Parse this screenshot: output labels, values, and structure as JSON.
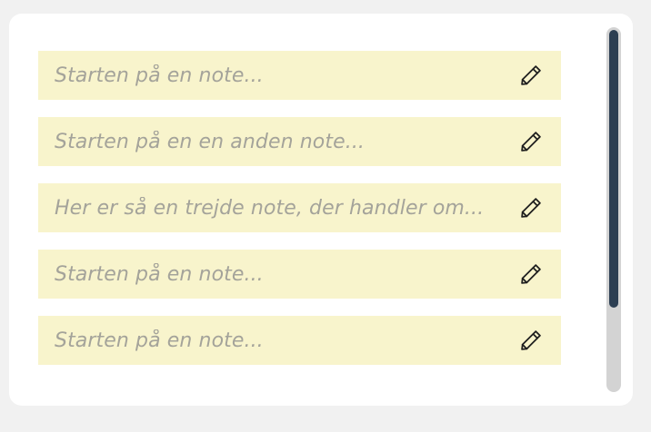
{
  "notes": [
    {
      "text": "Starten på en note...",
      "edit_icon": "pencil-icon"
    },
    {
      "text": "Starten på en en anden note...",
      "edit_icon": "pencil-icon"
    },
    {
      "text": "Her er så en trejde note, der handler om...",
      "edit_icon": "pencil-icon"
    },
    {
      "text": "Starten på en note...",
      "edit_icon": "pencil-icon"
    },
    {
      "text": "Starten på en note...",
      "edit_icon": "pencil-icon"
    }
  ],
  "colors": {
    "background": "#f1f1f1",
    "panel": "#ffffff",
    "note_background": "#f8f4cc",
    "note_text": "#a4a39a",
    "scroll_track": "#d3d3d3",
    "scroll_thumb": "#2c3e52"
  }
}
